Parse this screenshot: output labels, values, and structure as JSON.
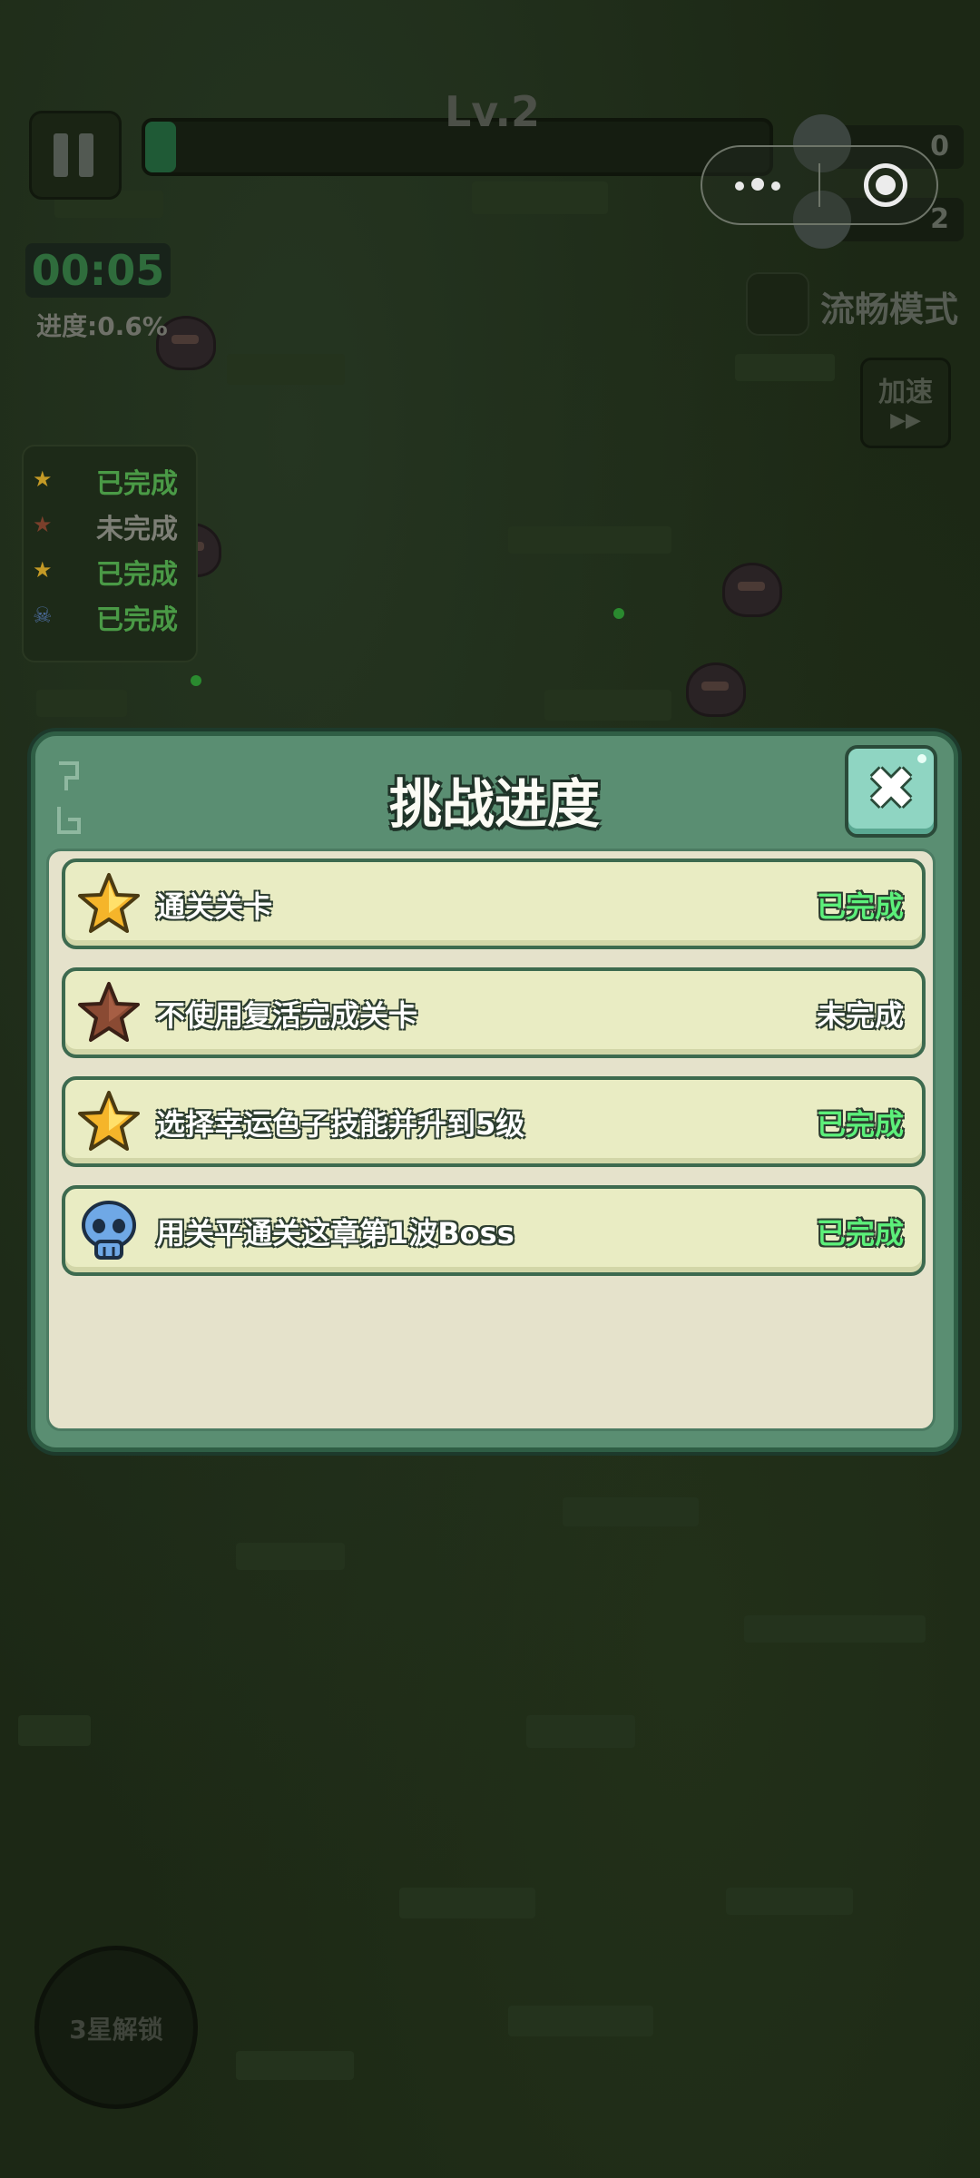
{
  "hud": {
    "level": "Lv.2",
    "level_progress": 0.05,
    "timer": "00:05",
    "progress_text": "进度:0.6%",
    "resource_1": "0",
    "resource_2": "2",
    "smooth_mode_label": "流畅模式",
    "speed_label": "加速",
    "speed_arrows": "▶▶",
    "unlock_label": "3星解锁"
  },
  "task_panel": [
    {
      "icon": "gold-star-icon",
      "glyph": "★",
      "status": "已完成",
      "color": "#4a9a46",
      "icon_color": "#c49a26"
    },
    {
      "icon": "bronze-star-icon",
      "glyph": "★",
      "status": "未完成",
      "color": "#7d7f76",
      "icon_color": "#7a3f2b"
    },
    {
      "icon": "gold-star-icon",
      "glyph": "★",
      "status": "已完成",
      "color": "#4a9a46",
      "icon_color": "#c49a26"
    },
    {
      "icon": "skull-icon",
      "glyph": "☠",
      "status": "已完成",
      "color": "#4a9a46",
      "icon_color": "#4b6a9a"
    }
  ],
  "modal": {
    "title": "挑战进度",
    "close_glyph": "✖",
    "challenges": [
      {
        "icon": "gold-star-icon",
        "label": "通关关卡",
        "status": "已完成",
        "status_color": "#5cf07a"
      },
      {
        "icon": "bronze-star-icon",
        "label": "不使用复活完成关卡",
        "status": "未完成",
        "status_color": "#ffffff"
      },
      {
        "icon": "gold-star-icon",
        "label": "选择幸运色子技能并升到5级",
        "status": "已完成",
        "status_color": "#5cf07a"
      },
      {
        "icon": "skull-icon",
        "label": "用关平通关这章第1波Boss",
        "status": "已完成",
        "status_color": "#5cf07a"
      }
    ]
  },
  "colors": {
    "completed": "#5cf07a",
    "incomplete": "#ffffff",
    "panel_frame": "#5a8e72",
    "panel_body": "#e5e2cb"
  }
}
